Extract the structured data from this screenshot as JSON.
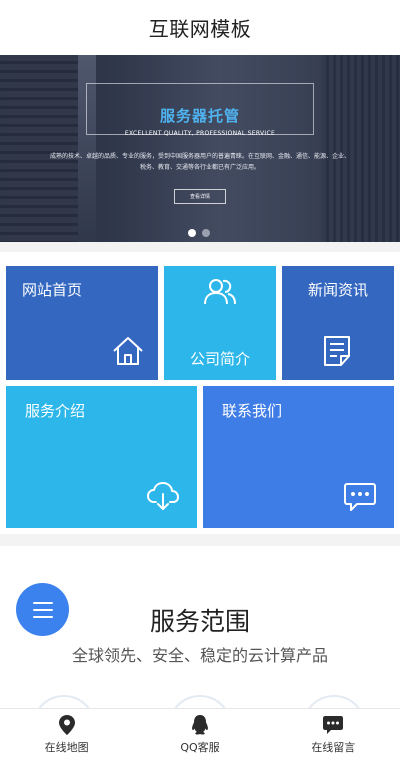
{
  "header": {
    "title": "互联网模板"
  },
  "banner": {
    "headline": "服务器托管",
    "subtitle": "EXCELLENT QUALITY, PROFESSIONAL SERVICE",
    "description": "成熟的技术、卓越的品质、专业的服务，受到中国服务器用户的普遍青睐。在互联网、金融、通信、能源、企业、税务、教育、交通等各行业都已有广泛应用。",
    "button_label": "查看详情",
    "slide_count": 2,
    "active_slide": 1
  },
  "tiles": {
    "home": "网站首页",
    "about": "公司简介",
    "news": "新闻资讯",
    "service": "服务介绍",
    "contact": "联系我们"
  },
  "section": {
    "title": "服务范围",
    "subtitle": "全球领先、安全、稳定的云计算产品"
  },
  "footer": {
    "map": "在线地图",
    "qq": "QQ客服",
    "message": "在线留言"
  },
  "colors": {
    "tile_dark_blue": "#3468c0",
    "tile_light_blue": "#2cb6ea",
    "tile_mid_blue": "#3f7de6",
    "fab_blue": "#3b82ee",
    "banner_headline": "#4fb3ef"
  },
  "icons": {
    "home": "house-icon",
    "about": "users-icon",
    "news": "document-icon",
    "service": "cloud-download-icon",
    "contact": "chat-bubble-icon",
    "menu": "menu-icon",
    "map": "location-pin-icon",
    "qq": "qq-penguin-icon",
    "message": "message-icon"
  }
}
